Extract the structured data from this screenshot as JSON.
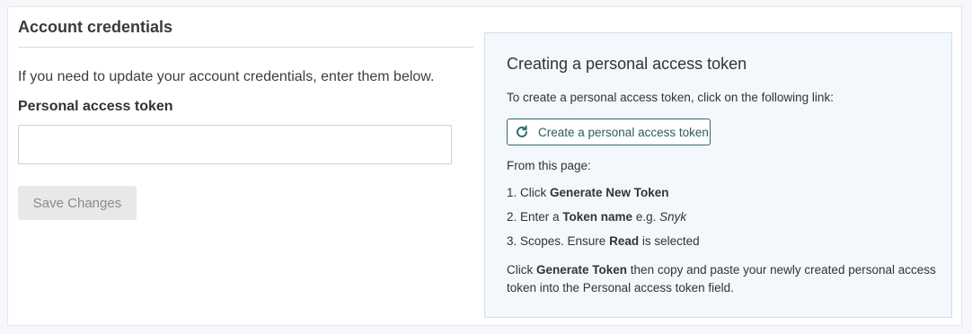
{
  "credentials": {
    "title": "Account credentials",
    "intro": "If you need to update your account credentials, enter them below.",
    "token_label": "Personal access token",
    "token_value": "",
    "save_label": "Save Changes"
  },
  "help": {
    "title": "Creating a personal access token",
    "instruction": "To create a personal access token, click on the following link:",
    "link_label": "Create a personal access token",
    "link_icon": "refresh-icon",
    "from_page": "From this page:",
    "steps": [
      {
        "prefix": "1. Click ",
        "bold": "Generate New Token",
        "suffix": ""
      },
      {
        "prefix": "2. Enter a ",
        "bold": "Token name",
        "suffix": " e.g. ",
        "italic": "Snyk"
      },
      {
        "prefix": "3. Scopes. Ensure ",
        "bold": "Read",
        "suffix": " is selected"
      }
    ],
    "footer_prefix": "Click ",
    "footer_bold": "Generate Token",
    "footer_suffix": " then copy and paste your newly created personal access token into the Personal access token field."
  },
  "colors": {
    "accent": "#2f6f6e",
    "help_bg": "#f4f7fb",
    "help_border": "#cfe0ee",
    "disabled_button": "#e8e8e8"
  }
}
